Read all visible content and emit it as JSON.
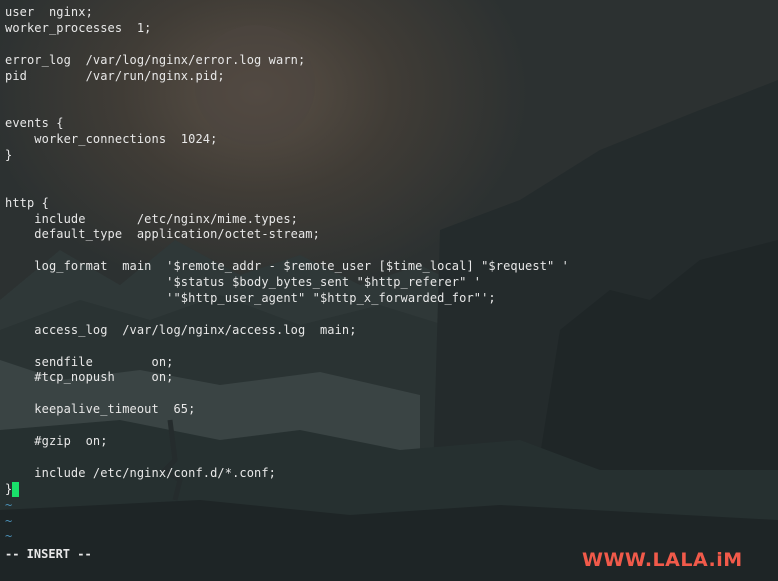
{
  "editor": {
    "lines": [
      "user  nginx;",
      "worker_processes  1;",
      "",
      "error_log  /var/log/nginx/error.log warn;",
      "pid        /var/run/nginx.pid;",
      "",
      "",
      "events {",
      "    worker_connections  1024;",
      "}",
      "",
      "",
      "http {",
      "    include       /etc/nginx/mime.types;",
      "    default_type  application/octet-stream;",
      "",
      "    log_format  main  '$remote_addr - $remote_user [$time_local] \"$request\" '",
      "                      '$status $body_bytes_sent \"$http_referer\" '",
      "                      '\"$http_user_agent\" \"$http_x_forwarded_for\"';",
      "",
      "    access_log  /var/log/nginx/access.log  main;",
      "",
      "    sendfile        on;",
      "    #tcp_nopush     on;",
      "",
      "    keepalive_timeout  65;",
      "",
      "    #gzip  on;",
      "",
      "    include /etc/nginx/conf.d/*.conf;",
      "}"
    ],
    "empty_line_markers": [
      "~",
      "~",
      "~"
    ],
    "mode": "-- INSERT --",
    "cursor_line": 31
  },
  "watermark": {
    "text": "WWW.LALA.iM",
    "color": "#f15a4a"
  },
  "colors": {
    "text": "#e8e8e8",
    "cursor": "#19e06a",
    "tilde": "#4a8fb5"
  }
}
